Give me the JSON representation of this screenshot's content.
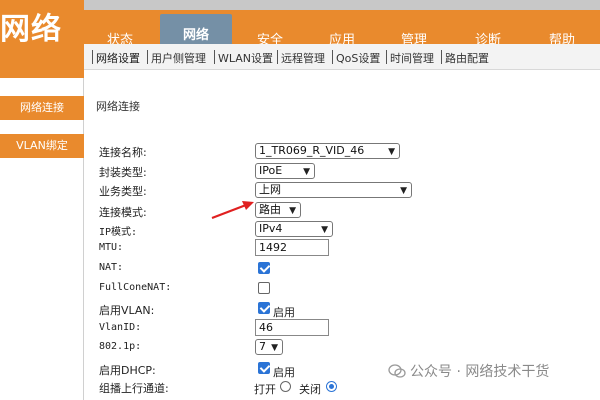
{
  "logo": {
    "text": "网络"
  },
  "main_nav": [
    {
      "label": "状态"
    },
    {
      "label": "网络"
    },
    {
      "label": "安全"
    },
    {
      "label": "应用"
    },
    {
      "label": "管理"
    },
    {
      "label": "诊断"
    },
    {
      "label": "帮助"
    }
  ],
  "sub_nav": [
    {
      "label": "网络设置"
    },
    {
      "label": "用户侧管理"
    },
    {
      "label": "WLAN设置"
    },
    {
      "label": "远程管理"
    },
    {
      "label": "QoS设置"
    },
    {
      "label": "时间管理"
    },
    {
      "label": "路由配置"
    }
  ],
  "sidebar": [
    {
      "label": "网络连接"
    },
    {
      "label": "VLAN绑定"
    }
  ],
  "content": {
    "section_title": "网络连接",
    "fields": {
      "conn_name": {
        "label": "连接名称:",
        "value": "1_TR069_R_VID_46"
      },
      "encap": {
        "label": "封装类型:",
        "value": "IPoE"
      },
      "service": {
        "label": "业务类型:",
        "value": "上网"
      },
      "conn_mode": {
        "label": "连接模式:",
        "value": "路由"
      },
      "ip_mode": {
        "label": "IP模式:",
        "value": "IPv4"
      },
      "mtu": {
        "label": "MTU:",
        "value": "1492"
      },
      "nat": {
        "label": "NAT:",
        "checked": true
      },
      "fullcone": {
        "label": "FullConeNAT:",
        "checked": false
      },
      "vlan_enable": {
        "label": "启用VLAN:",
        "checked": true,
        "check_label": "启用"
      },
      "vlan_id": {
        "label": "VlanID:",
        "value": "46"
      },
      "dot1p": {
        "label": "802.1p:",
        "value": "7"
      },
      "dhcp_enable": {
        "label": "启用DHCP:",
        "checked": true,
        "check_label": "启用"
      },
      "multicast": {
        "label": "组播上行通道:",
        "on_label": "打开",
        "off_label": "关闭",
        "selected": "关闭"
      }
    }
  },
  "watermark": {
    "text": "公众号 · 网络技术干货"
  },
  "colors": {
    "accent": "#e98a2d",
    "active_tab": "#7590a6",
    "checkbox": "#2b74d6",
    "arrow": "#e02020"
  }
}
